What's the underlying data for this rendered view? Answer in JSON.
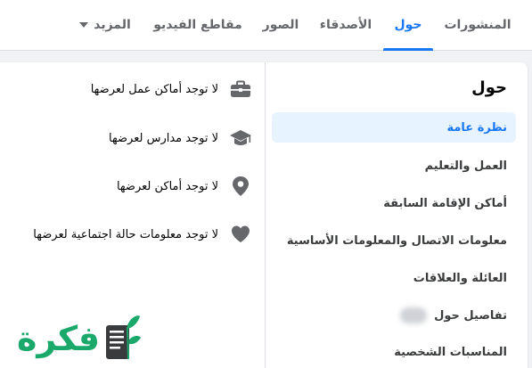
{
  "tabs": [
    {
      "label": "المنشورات"
    },
    {
      "label": "حول"
    },
    {
      "label": "الأصدقاء"
    },
    {
      "label": "الصور"
    },
    {
      "label": "مقاطع الفيديو"
    },
    {
      "label": "المزيد"
    }
  ],
  "sidebar": {
    "title": "حول",
    "items": [
      {
        "label": "نظرة عامة"
      },
      {
        "label": "العمل والتعليم"
      },
      {
        "label": "أماكن الإقامة السابقة"
      },
      {
        "label": "معلومات الاتصال والمعلومات الأساسية"
      },
      {
        "label": "العائلة والعلاقات"
      },
      {
        "label": "تفاصيل حول"
      },
      {
        "label": "المناسبات الشخصية"
      }
    ]
  },
  "overview": {
    "rows": [
      {
        "icon": "briefcase-icon",
        "text": "لا توجد أماكن عمل لعرضها"
      },
      {
        "icon": "graduation-cap-icon",
        "text": "لا توجد مدارس لعرضها"
      },
      {
        "icon": "location-pin-icon",
        "text": "لا توجد أماكن لعرضها"
      },
      {
        "icon": "heart-icon",
        "text": "لا توجد معلومات حالة اجتماعية لعرضها"
      }
    ]
  },
  "watermark": {
    "text": "فكرة"
  },
  "colors": {
    "accent": "#1877f2",
    "active_bg": "#e7f3ff",
    "icon": "#65676b",
    "logo": "#1aa96b"
  }
}
